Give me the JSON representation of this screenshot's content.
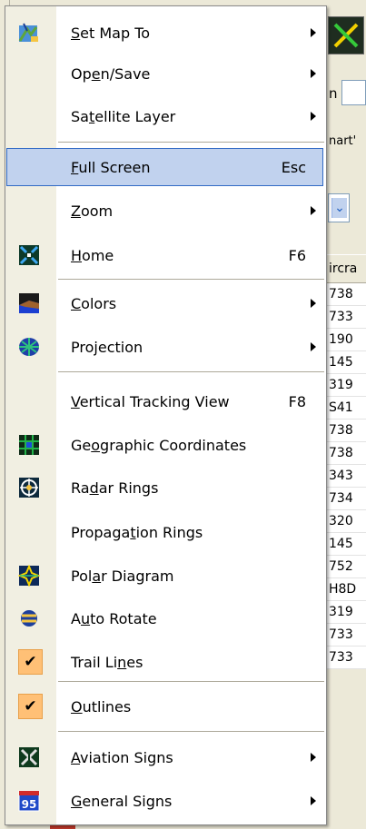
{
  "background": {
    "search_label": "n",
    "snippet_text": "nart'",
    "grid_header": "ircra",
    "grid_cells": [
      "738",
      "733",
      "190",
      "145",
      "319",
      "S41",
      "738",
      "738",
      "343",
      "734",
      "320",
      "145",
      "752",
      "H8D",
      "319",
      "733",
      "733"
    ]
  },
  "menu": {
    "items": [
      {
        "label_pre": "",
        "label_acc": "S",
        "label_post": "et Map To",
        "shortcut": "",
        "submenu": true,
        "icon": "set-map-icon"
      },
      {
        "label_pre": "Op",
        "label_acc": "e",
        "label_post": "n/Save",
        "shortcut": "",
        "submenu": true,
        "icon": ""
      },
      {
        "label_pre": "Sa",
        "label_acc": "t",
        "label_post": "ellite Layer",
        "shortcut": "",
        "submenu": true,
        "icon": ""
      },
      {
        "label_pre": "",
        "label_acc": "F",
        "label_post": "ull Screen",
        "shortcut": "Esc",
        "submenu": false,
        "icon": "",
        "highlighted": true
      },
      {
        "label_pre": "",
        "label_acc": "Z",
        "label_post": "oom",
        "shortcut": "",
        "submenu": true,
        "icon": ""
      },
      {
        "label_pre": "",
        "label_acc": "H",
        "label_post": "ome",
        "shortcut": "F6",
        "submenu": false,
        "icon": "home-icon"
      },
      {
        "label_pre": "",
        "label_acc": "C",
        "label_post": "olors",
        "shortcut": "",
        "submenu": true,
        "icon": "colors-icon"
      },
      {
        "label_pre": "Pro",
        "label_acc": "j",
        "label_post": "ection",
        "shortcut": "",
        "submenu": true,
        "icon": "projection-icon"
      },
      {
        "label_pre": "",
        "label_acc": "V",
        "label_post": "ertical Tracking View",
        "shortcut": "F8",
        "submenu": false,
        "icon": ""
      },
      {
        "label_pre": "Ge",
        "label_acc": "o",
        "label_post": "graphic Coordinates",
        "shortcut": "",
        "submenu": false,
        "icon": "geographic-coordinates-icon"
      },
      {
        "label_pre": "Ra",
        "label_acc": "d",
        "label_post": "ar Rings",
        "shortcut": "",
        "submenu": false,
        "icon": "radar-rings-icon"
      },
      {
        "label_pre": "Propaga",
        "label_acc": "t",
        "label_post": "ion Rings",
        "shortcut": "",
        "submenu": false,
        "icon": ""
      },
      {
        "label_pre": "Pol",
        "label_acc": "a",
        "label_post": "r Diagram",
        "shortcut": "",
        "submenu": false,
        "icon": "polar-diagram-icon"
      },
      {
        "label_pre": "A",
        "label_acc": "u",
        "label_post": "to Rotate",
        "shortcut": "",
        "submenu": false,
        "icon": "auto-rotate-icon"
      },
      {
        "label_pre": "Trail Li",
        "label_acc": "n",
        "label_post": "es",
        "shortcut": "",
        "submenu": false,
        "icon": "checkmark-icon",
        "checked": true
      },
      {
        "label_pre": "",
        "label_acc": "O",
        "label_post": "utlines",
        "shortcut": "",
        "submenu": false,
        "icon": "checkmark-icon",
        "checked": true
      },
      {
        "label_pre": "",
        "label_acc": "A",
        "label_post": "viation Signs",
        "shortcut": "",
        "submenu": true,
        "icon": "aviation-signs-icon"
      },
      {
        "label_pre": "",
        "label_acc": "G",
        "label_post": "eneral Signs",
        "shortcut": "",
        "submenu": true,
        "icon": "general-signs-icon"
      }
    ],
    "check_glyph": "✔",
    "general_signs_icon_text": "95",
    "highlight_color": "#c1d2ee",
    "check_bg_color": "#ffc076"
  }
}
